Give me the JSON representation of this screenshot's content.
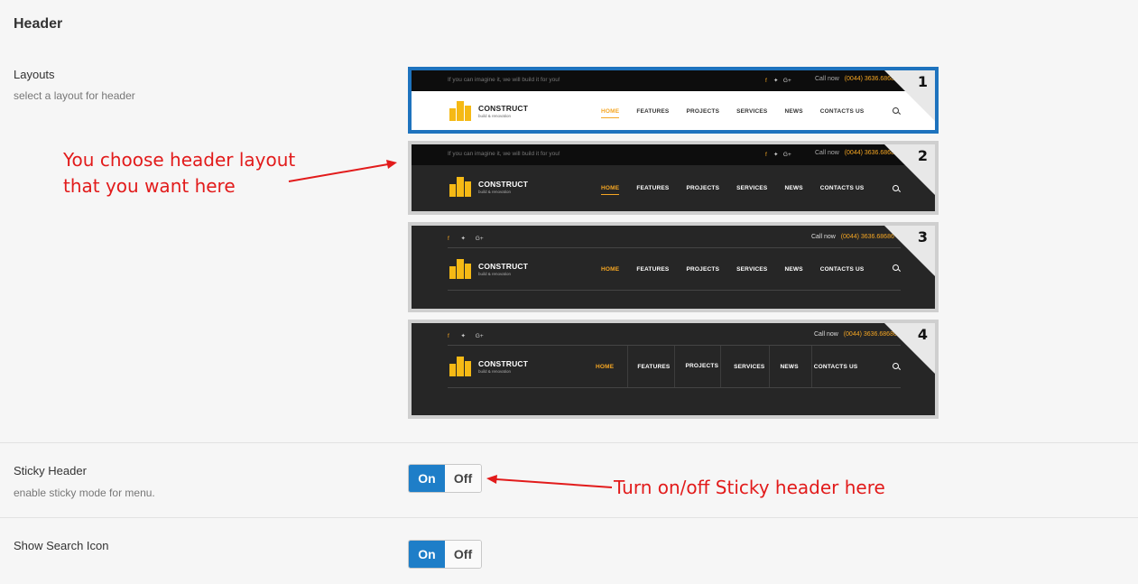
{
  "section": {
    "title": "Header"
  },
  "layouts": {
    "label": "Layouts",
    "description": "select a layout for header",
    "options": [
      {
        "number": "1",
        "selected": true
      },
      {
        "number": "2",
        "selected": false
      },
      {
        "number": "3",
        "selected": false
      },
      {
        "number": "4",
        "selected": false
      }
    ]
  },
  "preview": {
    "tagline": "If you can imagine it, we will build it for you!",
    "call_label": "Call now",
    "phone": "(0044) 3636.68686",
    "brand": "CONSTRUCT",
    "brand_sub": "build & renovation",
    "menu": [
      "HOME",
      "FEATURES",
      "PROJECTS",
      "SERVICES",
      "NEWS",
      "CONTACTS US"
    ],
    "social": {
      "facebook": "f",
      "twitter": "t",
      "googleplus": "G+"
    }
  },
  "sticky_header": {
    "label": "Sticky Header",
    "description": "enable sticky mode for menu.",
    "on_label": "On",
    "off_label": "Off",
    "value": "On"
  },
  "show_search_icon": {
    "label": "Show Search Icon",
    "on_label": "On",
    "off_label": "Off",
    "value": "On"
  },
  "annotations": {
    "layout_line1": "You choose header layout",
    "layout_line2": "that you want here",
    "sticky": "Turn on/off Sticky header  here"
  },
  "colors": {
    "accent": "#1e7ec8",
    "annotation": "#e21b1b",
    "brand": "#f5a623",
    "selected_border": "#1e73be"
  }
}
